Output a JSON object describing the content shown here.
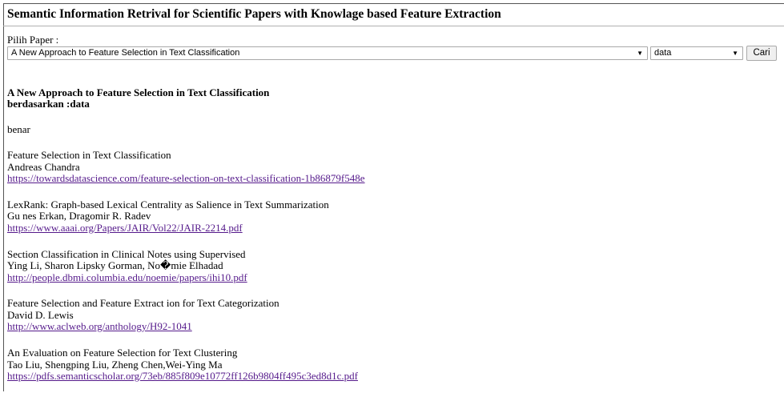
{
  "page": {
    "title": "Semantic Information Retrival for Scientific Papers with Knowlage based Feature Extraction"
  },
  "form": {
    "paper_label": "Pilih Paper :",
    "paper_selected": "A New Approach to Feature Selection in Text Classification",
    "keyword_selected": "data",
    "search_button": "Cari"
  },
  "result": {
    "title": "A New Approach to Feature Selection in Text Classification",
    "basis_label": "berdasarkan :",
    "basis_value": "data",
    "answer": "benar"
  },
  "references": [
    {
      "title": "Feature Selection in Text Classification",
      "authors": "Andreas Chandra",
      "url": "https://towardsdatascience.com/feature-selection-on-text-classification-1b86879f548e"
    },
    {
      "title": "LexRank: Graph-based Lexical Centrality as Salience in Text Summarization",
      "authors": "Gu nes Erkan, Dragomir R. Radev",
      "url": "https://www.aaai.org/Papers/JAIR/Vol22/JAIR-2214.pdf"
    },
    {
      "title": "Section Classification in Clinical Notes using Supervised",
      "authors": "Ying Li, Sharon Lipsky Gorman, No�mie Elhadad",
      "url": "http://people.dbmi.columbia.edu/noemie/papers/ihi10.pdf"
    },
    {
      "title": "Feature Selection and Feature Extract ion for Text Categorization",
      "authors": "David D. Lewis",
      "url": "http://www.aclweb.org/anthology/H92-1041"
    },
    {
      "title": "An Evaluation on Feature Selection for Text Clustering",
      "authors": "Tao Liu, Shengping Liu, Zheng Chen,Wei-Ying Ma",
      "url": "https://pdfs.semanticscholar.org/73eb/885f809e10772ff126b9804ff495c3ed8d1c.pdf"
    }
  ],
  "colors": {
    "link_visited": "#551a8b"
  },
  "icons": {
    "dropdown": "chevron-down-icon"
  }
}
